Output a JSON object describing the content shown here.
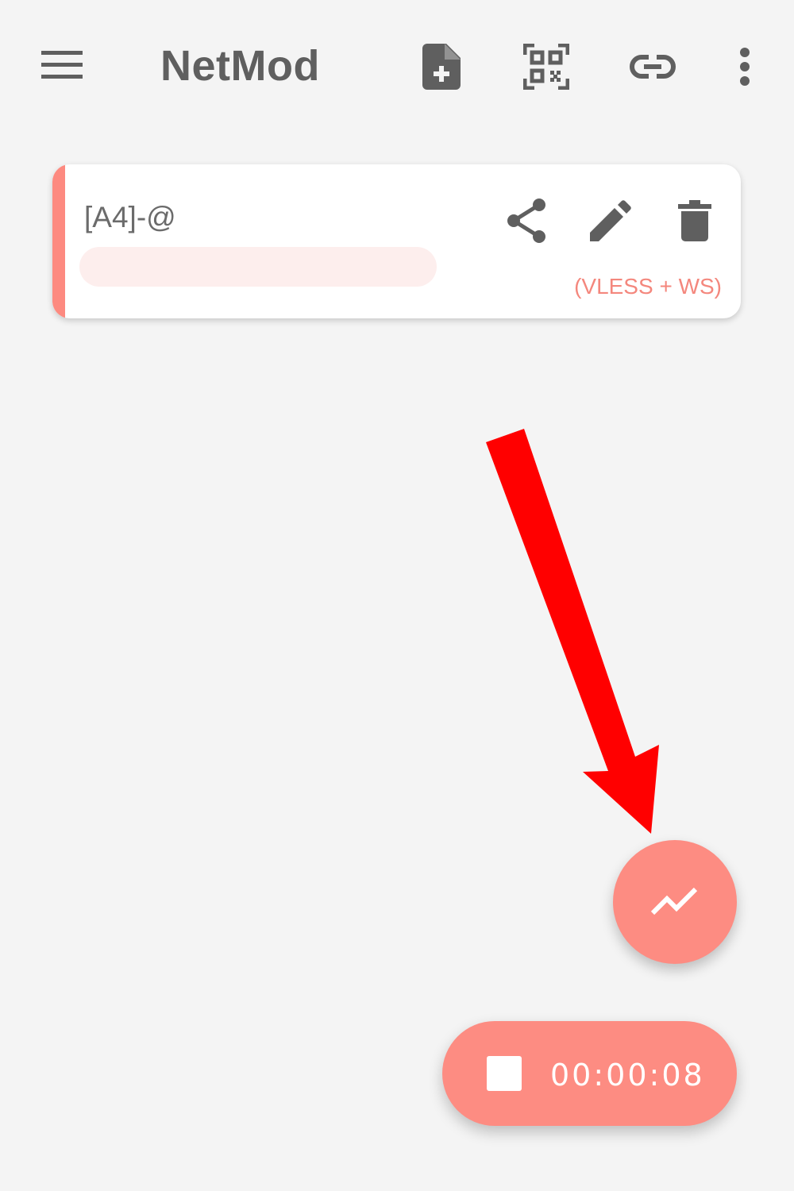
{
  "toolbar": {
    "title": "NetMod",
    "icons": [
      "menu-icon",
      "add-file-icon",
      "qr-code-icon",
      "link-icon",
      "more-vert-icon"
    ]
  },
  "config_card": {
    "name": "[A4]-@",
    "type_label": "(VLESS + WS)",
    "actions": [
      "share-icon",
      "edit-icon",
      "delete-icon"
    ]
  },
  "fab": {
    "icon": "trending-up-icon"
  },
  "connection": {
    "timer": "00:00:08",
    "icon": "stop-icon"
  },
  "colors": {
    "accent": "#fd8c82",
    "accent_text": "#f4877d",
    "annotation_arrow": "#ff0000",
    "background": "#f4f4f4",
    "icon_gray": "#5f5f5f"
  }
}
